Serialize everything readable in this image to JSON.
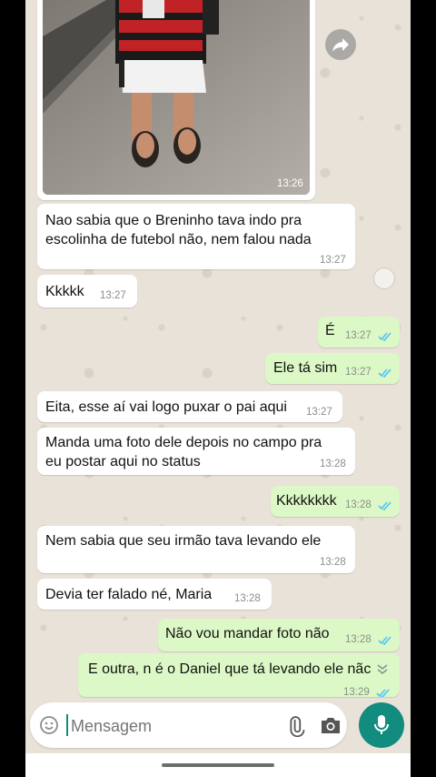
{
  "photo_message": {
    "time": "13:26"
  },
  "messages": [
    {
      "text": "Nao sabia que o Breninho tava indo pra\nescolinha de futebol não, nem falou nada",
      "time": "13:27"
    },
    {
      "text": "Kkkkk",
      "time": "13:27"
    },
    {
      "text": "É",
      "time": "13:27"
    },
    {
      "text": "Ele tá sim",
      "time": "13:27"
    },
    {
      "text": "Eita, esse aí vai logo puxar o pai aqui",
      "time": "13:27"
    },
    {
      "text": "Manda uma foto dele depois no campo pra\neu postar aqui no status",
      "time": "13:28"
    },
    {
      "text": "Kkkkkkkk",
      "time": "13:28"
    },
    {
      "text": "Nem sabia que seu irmão tava levando ele",
      "time": "13:28"
    },
    {
      "text": "Devia ter falado né, Maria",
      "time": "13:28"
    },
    {
      "text": "Não vou mandar foto não",
      "time": "13:28"
    },
    {
      "text": "E outra, n é o Daniel que tá levando ele nãc",
      "time": "13:29"
    }
  ],
  "composer": {
    "placeholder": "Mensagem"
  },
  "colors": {
    "incoming": "#ffffff",
    "outgoing": "#dcf8c6",
    "read_ticks": "#4fc3f7",
    "mic_button": "#128c7e"
  },
  "icons": [
    "forward-icon",
    "emoji-icon",
    "attach-icon",
    "camera-icon",
    "mic-icon",
    "double-check-icon",
    "chevron-down-icon"
  ]
}
